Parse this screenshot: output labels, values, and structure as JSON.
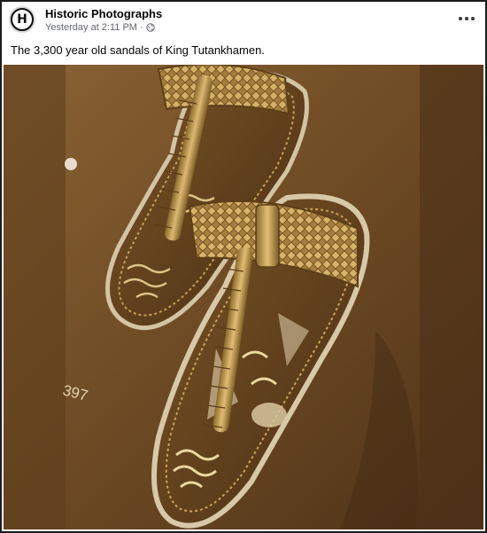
{
  "post": {
    "page_name": "Historic Photographs",
    "avatar_letter": "H",
    "timestamp": "Yesterday at 2:11 PM",
    "separator": "·",
    "visibility_icon": "globe-icon",
    "more_icon": "more-options-icon",
    "caption": "The 3,300 year old sandals of King Tutankhamen."
  },
  "photo": {
    "subject": "sandals",
    "museum_label_fragment": "397"
  },
  "colors": {
    "frame_border": "#1c1c1c",
    "name_text": "#050505",
    "meta_text": "#65676b",
    "photo_bg": "#6e4c26",
    "sandal_gold": "#c9a15a"
  }
}
